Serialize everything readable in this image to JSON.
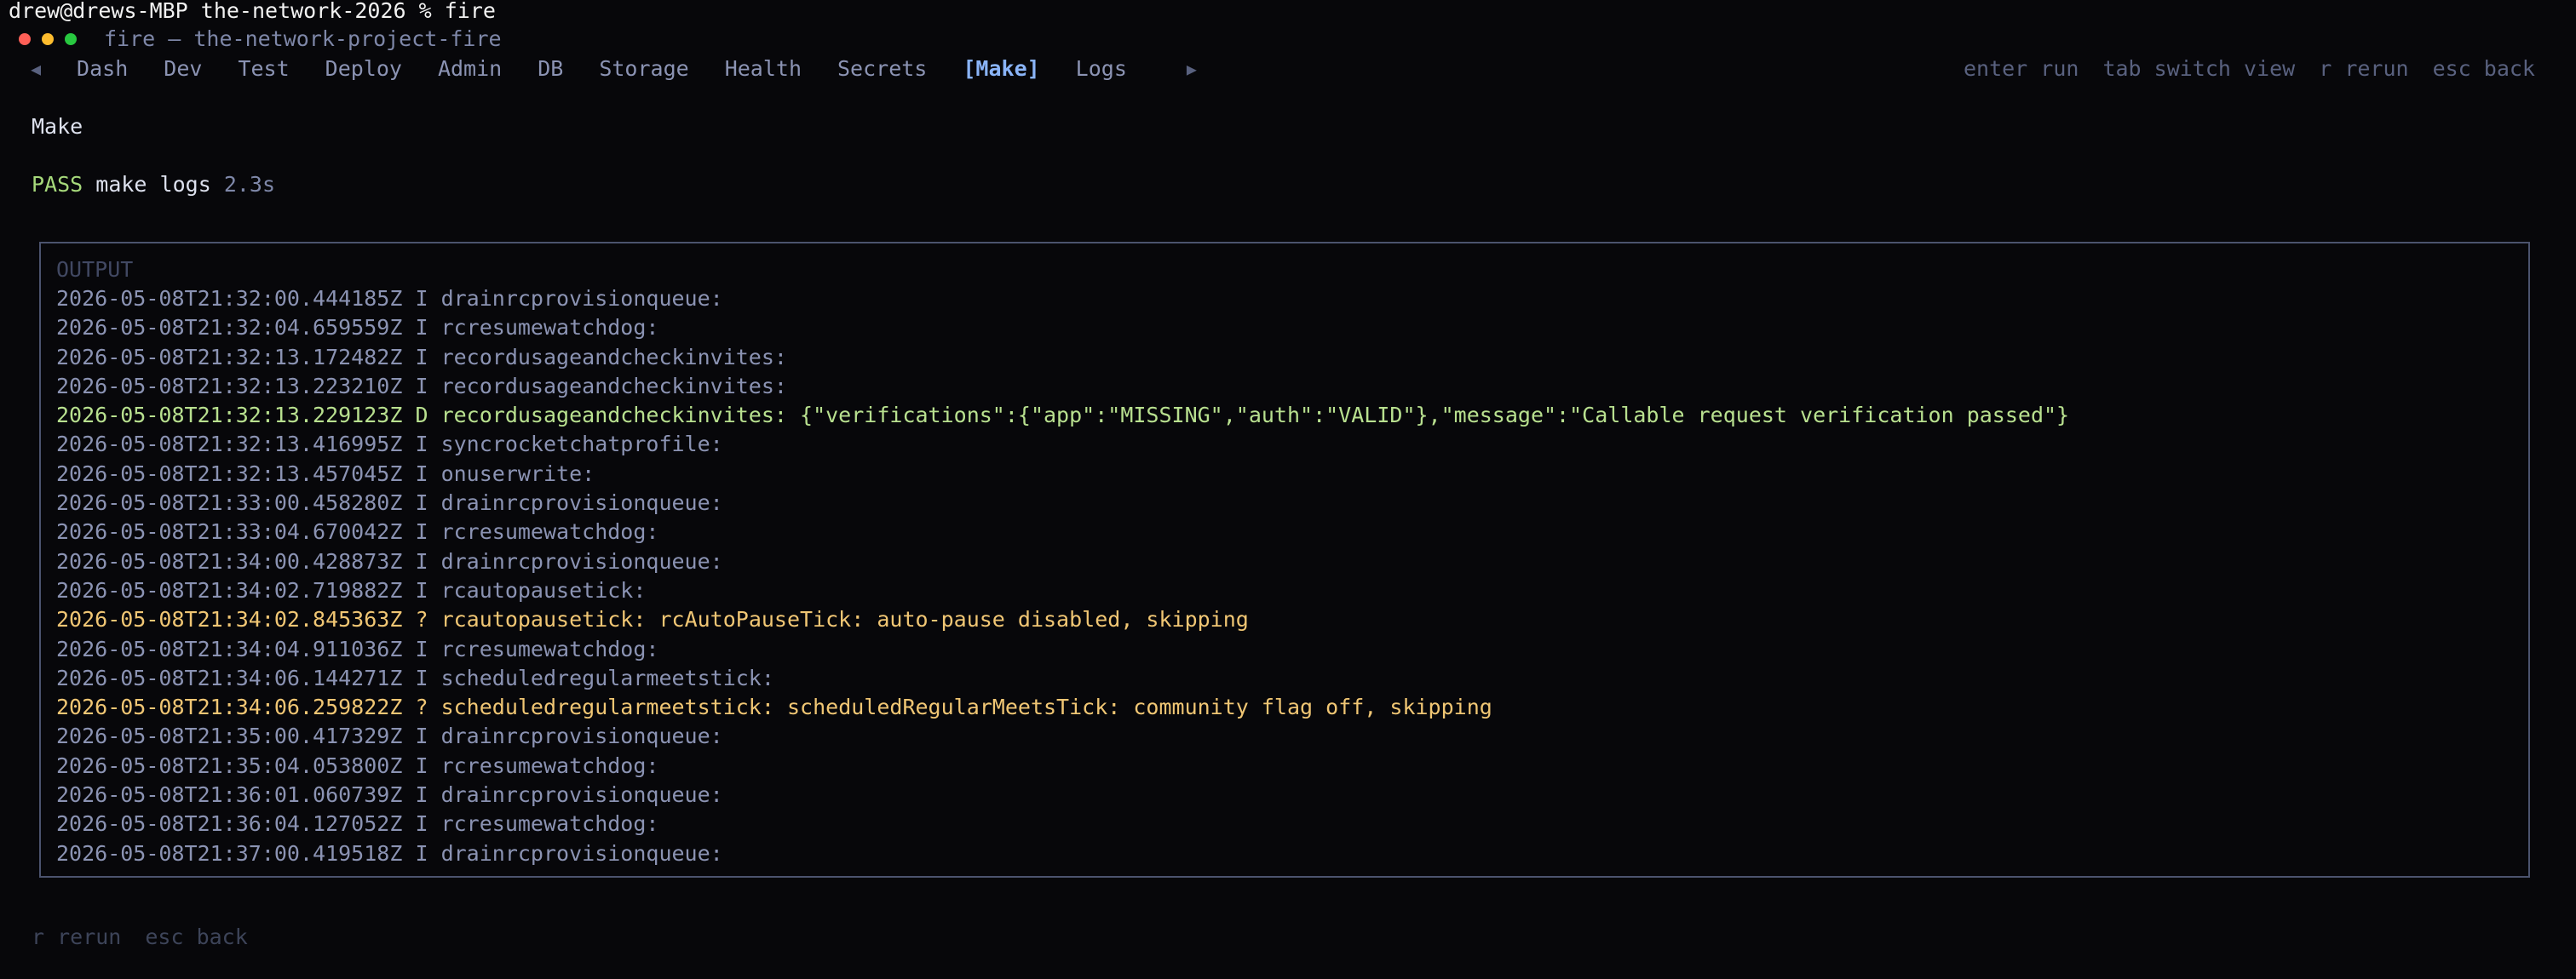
{
  "shell": {
    "prompt_line": "drew@drews-MBP the-network-2026 % fire"
  },
  "window": {
    "title": "fire — the-network-project-fire"
  },
  "tabs": {
    "left_arrow": "◀",
    "right_arrow": "▶",
    "items": [
      {
        "label": "Dash"
      },
      {
        "label": "Dev"
      },
      {
        "label": "Test"
      },
      {
        "label": "Deploy"
      },
      {
        "label": "Admin"
      },
      {
        "label": "DB"
      },
      {
        "label": "Storage"
      },
      {
        "label": "Health"
      },
      {
        "label": "Secrets"
      },
      {
        "label": "[Make]"
      },
      {
        "label": "Logs"
      }
    ],
    "active_index": 9
  },
  "hints": [
    "enter run",
    "tab switch view",
    "r rerun",
    "esc back"
  ],
  "section": {
    "title": "Make"
  },
  "status": {
    "result": "PASS",
    "command": "make logs",
    "duration": "2.3s"
  },
  "output": {
    "label": "OUTPUT",
    "lines": [
      {
        "ts": "2026-05-08T21:32:00.444185Z",
        "level": "I",
        "fn": "drainrcprovisionqueue:",
        "msg": ""
      },
      {
        "ts": "2026-05-08T21:32:04.659559Z",
        "level": "I",
        "fn": "rcresumewatchdog:",
        "msg": ""
      },
      {
        "ts": "2026-05-08T21:32:13.172482Z",
        "level": "I",
        "fn": "recordusageandcheckinvites:",
        "msg": ""
      },
      {
        "ts": "2026-05-08T21:32:13.223210Z",
        "level": "I",
        "fn": "recordusageandcheckinvites:",
        "msg": ""
      },
      {
        "ts": "2026-05-08T21:32:13.229123Z",
        "level": "D",
        "fn": "recordusageandcheckinvites:",
        "msg": "{\"verifications\":{\"app\":\"MISSING\",\"auth\":\"VALID\"},\"message\":\"Callable request verification passed\"}"
      },
      {
        "ts": "2026-05-08T21:32:13.416995Z",
        "level": "I",
        "fn": "syncrocketchatprofile:",
        "msg": ""
      },
      {
        "ts": "2026-05-08T21:32:13.457045Z",
        "level": "I",
        "fn": "onuserwrite:",
        "msg": ""
      },
      {
        "ts": "2026-05-08T21:33:00.458280Z",
        "level": "I",
        "fn": "drainrcprovisionqueue:",
        "msg": ""
      },
      {
        "ts": "2026-05-08T21:33:04.670042Z",
        "level": "I",
        "fn": "rcresumewatchdog:",
        "msg": ""
      },
      {
        "ts": "2026-05-08T21:34:00.428873Z",
        "level": "I",
        "fn": "drainrcprovisionqueue:",
        "msg": ""
      },
      {
        "ts": "2026-05-08T21:34:02.719882Z",
        "level": "I",
        "fn": "rcautopausetick:",
        "msg": ""
      },
      {
        "ts": "2026-05-08T21:34:02.845363Z",
        "level": "?",
        "fn": "rcautopausetick:",
        "msg": "rcAutoPauseTick: auto-pause disabled, skipping"
      },
      {
        "ts": "2026-05-08T21:34:04.911036Z",
        "level": "I",
        "fn": "rcresumewatchdog:",
        "msg": ""
      },
      {
        "ts": "2026-05-08T21:34:06.144271Z",
        "level": "I",
        "fn": "scheduledregularmeetstick:",
        "msg": ""
      },
      {
        "ts": "2026-05-08T21:34:06.259822Z",
        "level": "?",
        "fn": "scheduledregularmeetstick:",
        "msg": "scheduledRegularMeetsTick: community flag off, skipping"
      },
      {
        "ts": "2026-05-08T21:35:00.417329Z",
        "level": "I",
        "fn": "drainrcprovisionqueue:",
        "msg": ""
      },
      {
        "ts": "2026-05-08T21:35:04.053800Z",
        "level": "I",
        "fn": "rcresumewatchdog:",
        "msg": ""
      },
      {
        "ts": "2026-05-08T21:36:01.060739Z",
        "level": "I",
        "fn": "drainrcprovisionqueue:",
        "msg": ""
      },
      {
        "ts": "2026-05-08T21:36:04.127052Z",
        "level": "I",
        "fn": "rcresumewatchdog:",
        "msg": ""
      },
      {
        "ts": "2026-05-08T21:37:00.419518Z",
        "level": "I",
        "fn": "drainrcprovisionqueue:",
        "msg": ""
      }
    ]
  },
  "footer": [
    "r rerun",
    "esc back"
  ],
  "colors": {
    "background": "#07070a",
    "active_tab": "#8ab4f8",
    "pass": "#a6d97b",
    "debug_line": "#b8e08f",
    "warn_line": "#f0c674",
    "info_line": "#8b93b3",
    "border": "#4b536e"
  }
}
